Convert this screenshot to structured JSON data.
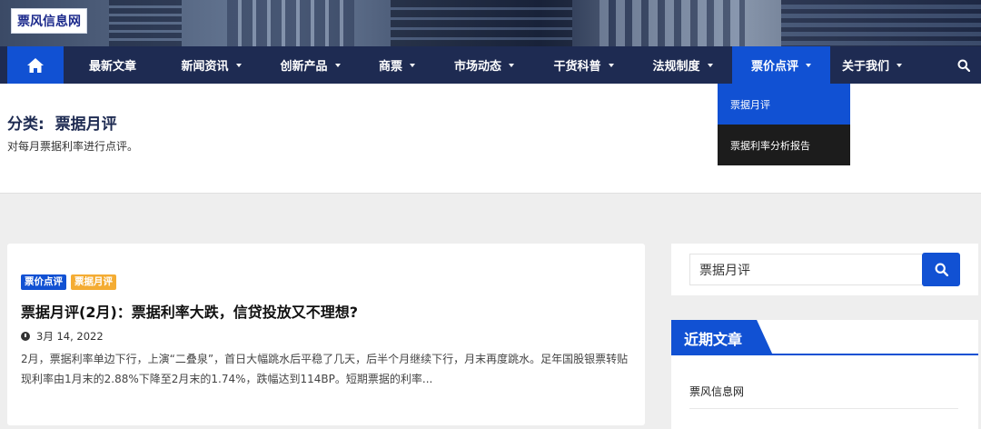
{
  "site": {
    "logo_text": "票风信息网"
  },
  "nav": {
    "items": [
      {
        "label": "最新文章",
        "has_caret": false
      },
      {
        "label": "新闻资讯",
        "has_caret": true
      },
      {
        "label": "创新产品",
        "has_caret": true
      },
      {
        "label": "商票",
        "has_caret": true
      },
      {
        "label": "市场动态",
        "has_caret": true
      },
      {
        "label": "干货科普",
        "has_caret": true
      },
      {
        "label": "法规制度",
        "has_caret": true
      },
      {
        "label": "票价点评",
        "has_caret": true,
        "active": true
      },
      {
        "label": "关于我们",
        "has_caret": true
      }
    ],
    "home_icon": "home-icon",
    "search_icon": "search-icon"
  },
  "dropdown": {
    "items": [
      {
        "label": "票据月评",
        "active": true
      },
      {
        "label": "票据利率分析报告",
        "active": false
      }
    ]
  },
  "category": {
    "prefix": "分类:",
    "name": "票据月评",
    "description": "对每月票据利率进行点评。"
  },
  "article": {
    "tags": [
      "票价点评",
      "票据月评"
    ],
    "title": "票据月评(2月)：票据利率大跌，信贷投放又不理想?",
    "date": "3月 14, 2022",
    "excerpt": "2月，票据利率单边下行，上演“二叠泉”，首日大幅跳水后平稳了几天，后半个月继续下行，月末再度跳水。足年国股银票转贴现利率由1月末的2.88%下降至2月末的1.74%，跌幅达到114BP。短期票据的利率..."
  },
  "sidebar": {
    "search": {
      "value": "票据月评"
    },
    "recent": {
      "title": "近期文章",
      "items": [
        "票风信息网"
      ]
    }
  },
  "colors": {
    "accent": "#1151d3",
    "nav_bg": "#1e2b52",
    "tag_orange": "#f4ac33"
  }
}
